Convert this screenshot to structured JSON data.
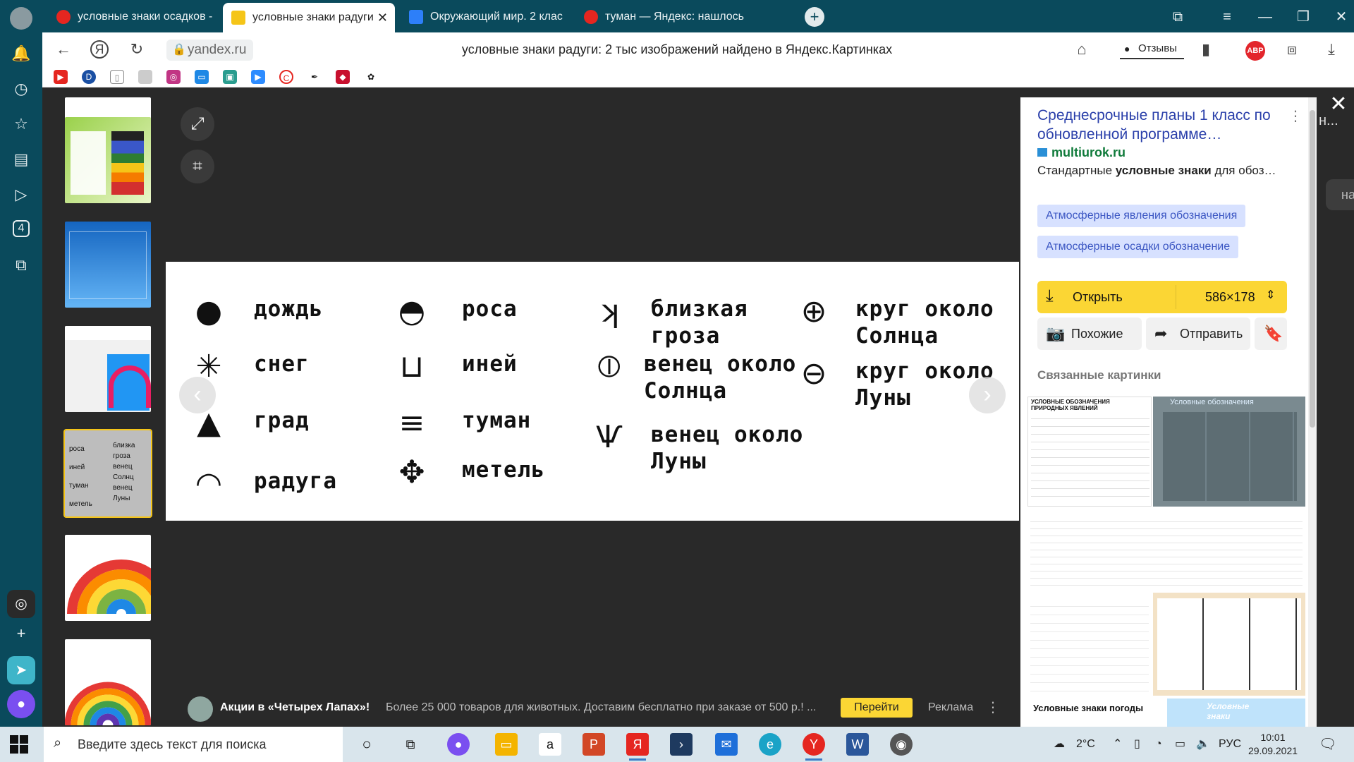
{
  "browser": {
    "tabs": [
      {
        "label": "условные знаки осадков -",
        "active": false,
        "fav_color": "#e52620"
      },
      {
        "label": "условные знаки радуги",
        "active": true,
        "fav_color": "#f5c518"
      },
      {
        "label": "Окружающий мир. 2 клас",
        "active": false,
        "fav_color": "#2d7ff9"
      },
      {
        "label": "туман — Яндекс: нашлось",
        "active": false,
        "fav_color": "#e52620"
      }
    ],
    "tab_close_glyph": "✕",
    "new_tab_glyph": "+",
    "address": "yandex.ru",
    "page_title": "условные знаки радуги: 2 тыс изображений найдено в Яндекс.Картинках",
    "reviews_label": "Отзывы",
    "abp_label": "ABP",
    "sidepanel_badge": "4"
  },
  "viewer": {
    "close_glyph": "✕",
    "prev_glyph": "‹",
    "next_glyph": "›",
    "right_stub_text": "н...",
    "right_stub2_text": "на"
  },
  "symbols": [
    {
      "glyph": "●",
      "label": "дождь"
    },
    {
      "glyph": "✳",
      "label": "снег"
    },
    {
      "glyph": "▲",
      "label": "град"
    },
    {
      "glyph": "◠",
      "label": "радуга"
    },
    {
      "glyph": "◓",
      "label": "роса"
    },
    {
      "glyph": "⊔",
      "label": "иней"
    },
    {
      "glyph": "≡",
      "label": "туман"
    },
    {
      "glyph": "✥",
      "label": "метель"
    },
    {
      "glyph": "ʞ",
      "label": "близкая гроза"
    },
    {
      "glyph": "⦶",
      "label": "венец около Солнца"
    },
    {
      "glyph": "Ѱ",
      "label": "венец около Луны"
    },
    {
      "glyph": "⊕",
      "label": "круг около Солнца"
    },
    {
      "glyph": "⊖",
      "label": "круг около Луны"
    }
  ],
  "thumbnail_labels": [
    "роса",
    "иней",
    "туман",
    "метель",
    "близка",
    "гроза",
    "венец",
    "Солнц",
    "венец",
    "Луны"
  ],
  "ad": {
    "title": "Акции в «Четырех Лапах»!",
    "text": "Более 25 000 товаров для животных. Доставим бесплатно при заказе от 500 р.! ...",
    "button": "Перейти",
    "label": "Реклама"
  },
  "info_panel": {
    "title": "Среднесрочные планы 1 класс по обновленной программе…",
    "site": "multiurok.ru",
    "desc_before": "Стандартные ",
    "desc_bold": "условные знаки",
    "desc_after": " для обоз…",
    "chips": [
      "Атмосферные явления обозначения",
      "Атмосферные осадки обозначение"
    ],
    "open_label": "Открыть",
    "size_label": "586×178",
    "similar_label": "Похожие",
    "send_label": "Отправить",
    "related_label": "Связанные картинки",
    "related_captions": [
      "УСЛОВНЫЕ ОБОЗНАЧЕНИЯ ПРИРОДНЫХ ЯВЛЕНИЙ",
      "Условные обозначения",
      "Условные знаки погоды",
      "Условные знаки"
    ]
  },
  "taskbar": {
    "search_placeholder": "Введите здесь текст для поиска",
    "temperature": "2°C",
    "language": "РУС",
    "time": "10:01",
    "date": "29.09.2021"
  },
  "colors": {
    "chrome": "#0a4a5c",
    "accent": "#fbd634",
    "link": "#2a3faa"
  }
}
